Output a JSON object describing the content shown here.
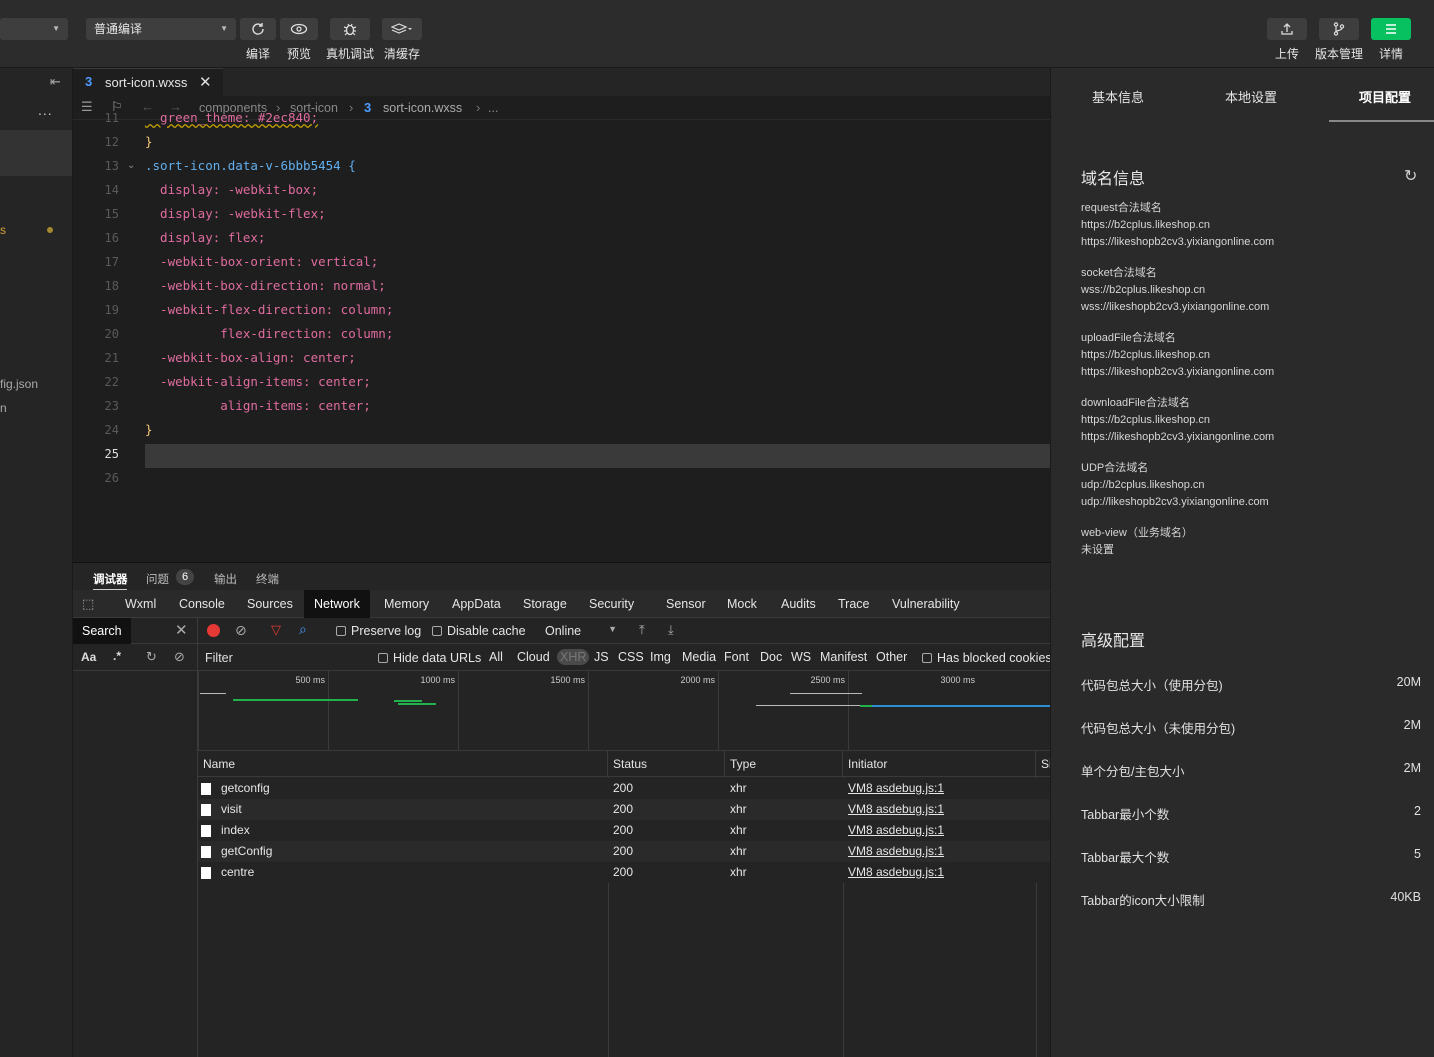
{
  "toolbar": {
    "compile_mode": "普通编译",
    "buttons": [
      {
        "label": "编译",
        "icon": "refresh-icon"
      },
      {
        "label": "预览",
        "icon": "eye-icon"
      },
      {
        "label": "真机调试",
        "icon": "bug-icon"
      },
      {
        "label": "清缓存",
        "icon": "layers-icon"
      }
    ],
    "right_buttons": [
      {
        "label": "上传",
        "icon": "upload-icon"
      },
      {
        "label": "版本管理",
        "icon": "branch-icon"
      },
      {
        "label": "详情",
        "icon": "menu-icon"
      }
    ]
  },
  "sidebar": {
    "more": "...",
    "partial_items": [
      "s",
      "fig.json",
      "n"
    ]
  },
  "editor": {
    "tab": "sort-icon.wxss",
    "breadcrumb": [
      "components",
      "sort-icon",
      "sort-icon.wxss",
      "..."
    ],
    "lines": [
      {
        "n": "11",
        "t": "  green_theme: #2ec840;"
      },
      {
        "n": "12",
        "t": "}"
      },
      {
        "n": "13",
        "t": ".sort-icon.data-v-6bbb5454 {"
      },
      {
        "n": "14",
        "t": "  display: -webkit-box;"
      },
      {
        "n": "15",
        "t": "  display: -webkit-flex;"
      },
      {
        "n": "16",
        "t": "  display: flex;"
      },
      {
        "n": "17",
        "t": "  -webkit-box-orient: vertical;"
      },
      {
        "n": "18",
        "t": "  -webkit-box-direction: normal;"
      },
      {
        "n": "19",
        "t": "  -webkit-flex-direction: column;"
      },
      {
        "n": "20",
        "t": "          flex-direction: column;"
      },
      {
        "n": "21",
        "t": "  -webkit-box-align: center;"
      },
      {
        "n": "22",
        "t": "  -webkit-align-items: center;"
      },
      {
        "n": "23",
        "t": "          align-items: center;"
      },
      {
        "n": "24",
        "t": "}"
      },
      {
        "n": "25",
        "t": ""
      },
      {
        "n": "26",
        "t": ""
      }
    ]
  },
  "devtools": {
    "panel_tabs": [
      "调试器",
      "问题",
      "输出",
      "终端"
    ],
    "issues_count": "6",
    "tabs": [
      "Wxml",
      "Console",
      "Sources",
      "Network",
      "Memory",
      "AppData",
      "Storage",
      "Security",
      "Sensor",
      "Mock",
      "Audits",
      "Trace",
      "Vulnerability"
    ],
    "active_tab": "Network",
    "search_label": "Search",
    "search_opts": [
      "Aa",
      ".*"
    ],
    "preserve_log": "Preserve log",
    "disable_cache": "Disable cache",
    "throttle": "Online",
    "filter_placeholder": "Filter",
    "hide_data_urls": "Hide data URLs",
    "filter_types": [
      "All",
      "Cloud",
      "XHR",
      "JS",
      "CSS",
      "Img",
      "Media",
      "Font",
      "Doc",
      "WS",
      "Manifest",
      "Other"
    ],
    "active_filter": "XHR",
    "blocked_cookies": "Has blocked cookies",
    "timeline_ticks": [
      "500 ms",
      "1000 ms",
      "1500 ms",
      "2000 ms",
      "2500 ms",
      "3000 ms"
    ],
    "table_headers": [
      "Name",
      "Status",
      "Type",
      "Initiator",
      "Si"
    ],
    "rows": [
      {
        "name": "getconfig",
        "status": "200",
        "type": "xhr",
        "initiator": "VM8 asdebug.js:1"
      },
      {
        "name": "visit",
        "status": "200",
        "type": "xhr",
        "initiator": "VM8 asdebug.js:1"
      },
      {
        "name": "index",
        "status": "200",
        "type": "xhr",
        "initiator": "VM8 asdebug.js:1"
      },
      {
        "name": "getConfig",
        "status": "200",
        "type": "xhr",
        "initiator": "VM8 asdebug.js:1"
      },
      {
        "name": "centre",
        "status": "200",
        "type": "xhr",
        "initiator": "VM8 asdebug.js:1"
      }
    ]
  },
  "details": {
    "tabs": [
      "基本信息",
      "本地设置",
      "项目配置"
    ],
    "active_tab": "项目配置",
    "domain_title": "域名信息",
    "domains": [
      {
        "label": "request合法域名",
        "values": [
          "https://b2cplus.likeshop.cn",
          "https://likeshopb2cv3.yixiangonline.com"
        ]
      },
      {
        "label": "socket合法域名",
        "values": [
          "wss://b2cplus.likeshop.cn",
          "wss://likeshopb2cv3.yixiangonline.com"
        ]
      },
      {
        "label": "uploadFile合法域名",
        "values": [
          "https://b2cplus.likeshop.cn",
          "https://likeshopb2cv3.yixiangonline.com"
        ]
      },
      {
        "label": "downloadFile合法域名",
        "values": [
          "https://b2cplus.likeshop.cn",
          "https://likeshopb2cv3.yixiangonline.com"
        ]
      },
      {
        "label": "UDP合法域名",
        "values": [
          "udp://b2cplus.likeshop.cn",
          "udp://likeshopb2cv3.yixiangonline.com"
        ]
      },
      {
        "label": "web-view（业务域名）",
        "values": [
          "未设置"
        ]
      }
    ],
    "advanced_title": "高级配置",
    "advanced": [
      {
        "label": "代码包总大小（使用分包)",
        "value": "20M"
      },
      {
        "label": "代码包总大小（未使用分包)",
        "value": "2M"
      },
      {
        "label": "单个分包/主包大小",
        "value": "2M"
      },
      {
        "label": "Tabbar最小个数",
        "value": "2"
      },
      {
        "label": "Tabbar最大个数",
        "value": "5"
      },
      {
        "label": "Tabbar的icon大小限制",
        "value": "40KB"
      }
    ]
  },
  "colors": {
    "accent": "#07c160",
    "record": "#e53935",
    "link_blue": "#4e9cff",
    "code_selector": "#61afef",
    "code_prop": "#e06c9f",
    "code_value": "#e5a83c"
  }
}
